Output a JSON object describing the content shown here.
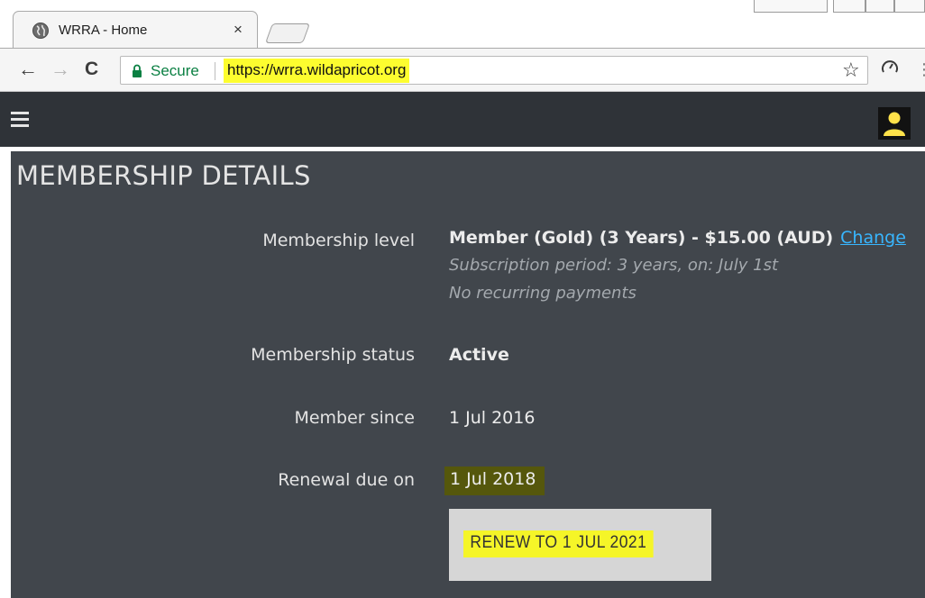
{
  "browser": {
    "tab": {
      "title": "WRRA - Home",
      "close_glyph": "×",
      "favicon": "globe-icon"
    },
    "nav": {
      "back_glyph": "←",
      "forward_glyph": "→",
      "reload_glyph": "C"
    },
    "omnibox": {
      "secure_label": "Secure",
      "url": "https://wrra.wildapricot.org"
    },
    "star_glyph": "☆",
    "menu_glyph": "⋮",
    "colors": {
      "secure": "#0b8043",
      "url_highlight": "#fdfd2f"
    }
  },
  "site_header": {
    "menu_icon": "hamburger-icon",
    "user_icon": "user-icon",
    "user_icon_color": "#ffe24a"
  },
  "page": {
    "title": "MEMBERSHIP DETAILS",
    "membership_level": {
      "label": "Membership level",
      "value": "Member (Gold) (3 Years) - $15.00 (AUD)",
      "change_link": "Change",
      "subscription_period": "Subscription period: 3 years, on: July 1st",
      "recurring": "No recurring payments"
    },
    "membership_status": {
      "label": "Membership status",
      "value": "Active"
    },
    "member_since": {
      "label": "Member since",
      "value": "1 Jul 2016"
    },
    "renewal_due": {
      "label": "Renewal due on",
      "value": "1 Jul 2018"
    },
    "renew_button": {
      "label": "RENEW TO 1 JUL 2021"
    },
    "colors": {
      "background": "#41464c",
      "link": "#38b6ff",
      "highlight": "#f5f528"
    }
  }
}
